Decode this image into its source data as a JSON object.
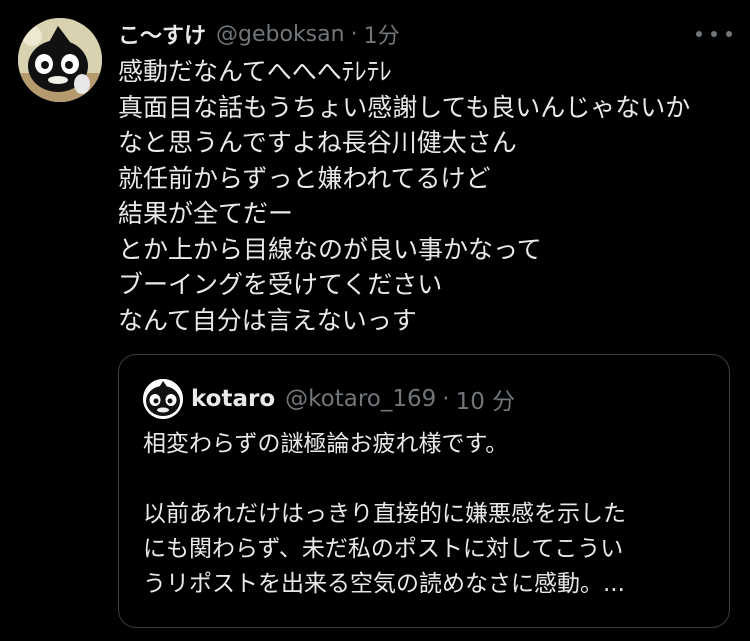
{
  "tweet": {
    "display_name": "こ〜すけ",
    "handle": "@geboksan",
    "separator": "·",
    "time": "1分",
    "avatar_icon": "character-avatar-icon",
    "more_icon": "more-options-icon",
    "lines": [
      "感動だなんてへへへﾃﾚﾃﾚ",
      "真面目な話もうちょい感謝しても良いんじゃないか",
      "なと思うんですよね長谷川健太さん",
      "就任前からずっと嫌われてるけど",
      "結果が全てだー",
      "とか上から目線なのが良い事かなって",
      "ブーイングを受けてください",
      "なんて自分は言えないっす"
    ]
  },
  "quote": {
    "display_name": "kotaro",
    "handle": "@kotaro_169",
    "separator": "·",
    "time": "10 分",
    "avatar_icon": "character-avatar-icon",
    "lines": [
      "相変わらずの謎極論お疲れ様です。",
      "",
      "以前あれだけはっきり直接的に嫌悪感を示した",
      "にも関わらず、未だ私のポストに対してこうい",
      "うリポストを出来る空気の読めなさに感動。..."
    ]
  },
  "colors": {
    "background": "#000000",
    "text": "#e7e9ea",
    "secondary_text": "#71767b",
    "quote_border": "#3a3d41"
  }
}
